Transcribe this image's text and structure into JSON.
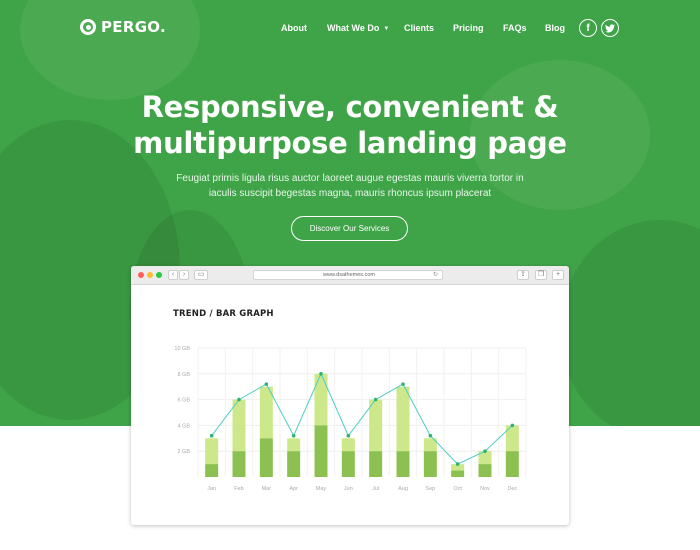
{
  "brand": {
    "logo_text": "PERGO."
  },
  "nav": {
    "items": [
      "About",
      "What We Do",
      "Clients",
      "Pricing",
      "FAQs",
      "Blog"
    ],
    "dropdown_index": 1,
    "social": [
      {
        "icon": "facebook-icon",
        "glyph": "f"
      },
      {
        "icon": "twitter-icon",
        "glyph": "t"
      }
    ]
  },
  "hero": {
    "headline_line1": "Responsive, convenient &",
    "headline_line2": "multipurpose landing page",
    "subtext_line1": "Feugiat primis ligula risus auctor laoreet augue egestas mauris viverra tortor in",
    "subtext_line2": "iaculis suscipit begestas magna, mauris rhoncus ipsum placerat",
    "cta_label": "Discover Our Services"
  },
  "browser": {
    "url": "www.dsathemes.com",
    "window_dots": [
      "#ff5f57",
      "#febc2e",
      "#28c840"
    ]
  },
  "colors": {
    "hero_bg": "#3fa447",
    "bar_dark": "#8cc152",
    "bar_light": "#cde88a",
    "line": "#4ecdc4",
    "point": "#2fb36f"
  },
  "chart_data": {
    "type": "bar",
    "title": "TREND / BAR GRAPH",
    "categories": [
      "Jan",
      "Feb",
      "Mar",
      "Apr",
      "May",
      "Jun",
      "Jul",
      "Aug",
      "Sep",
      "Oct",
      "Nov",
      "Dec"
    ],
    "series": [
      {
        "values": [
          1,
          2,
          3,
          2,
          4,
          2,
          2,
          2,
          2,
          0.5,
          1,
          2
        ]
      },
      {
        "values": [
          2,
          4,
          4,
          1,
          4,
          1,
          4,
          5,
          1,
          0.5,
          1,
          2
        ]
      }
    ],
    "line_values": [
      3.2,
      6,
      7.2,
      3.2,
      8,
      3.2,
      6,
      7.2,
      3.2,
      1,
      2,
      4
    ],
    "yticks": [
      "2 GB",
      "4 GB",
      "6 GB",
      "8 GB",
      "10 GB"
    ],
    "ylim": [
      0,
      10
    ],
    "grid": true
  }
}
